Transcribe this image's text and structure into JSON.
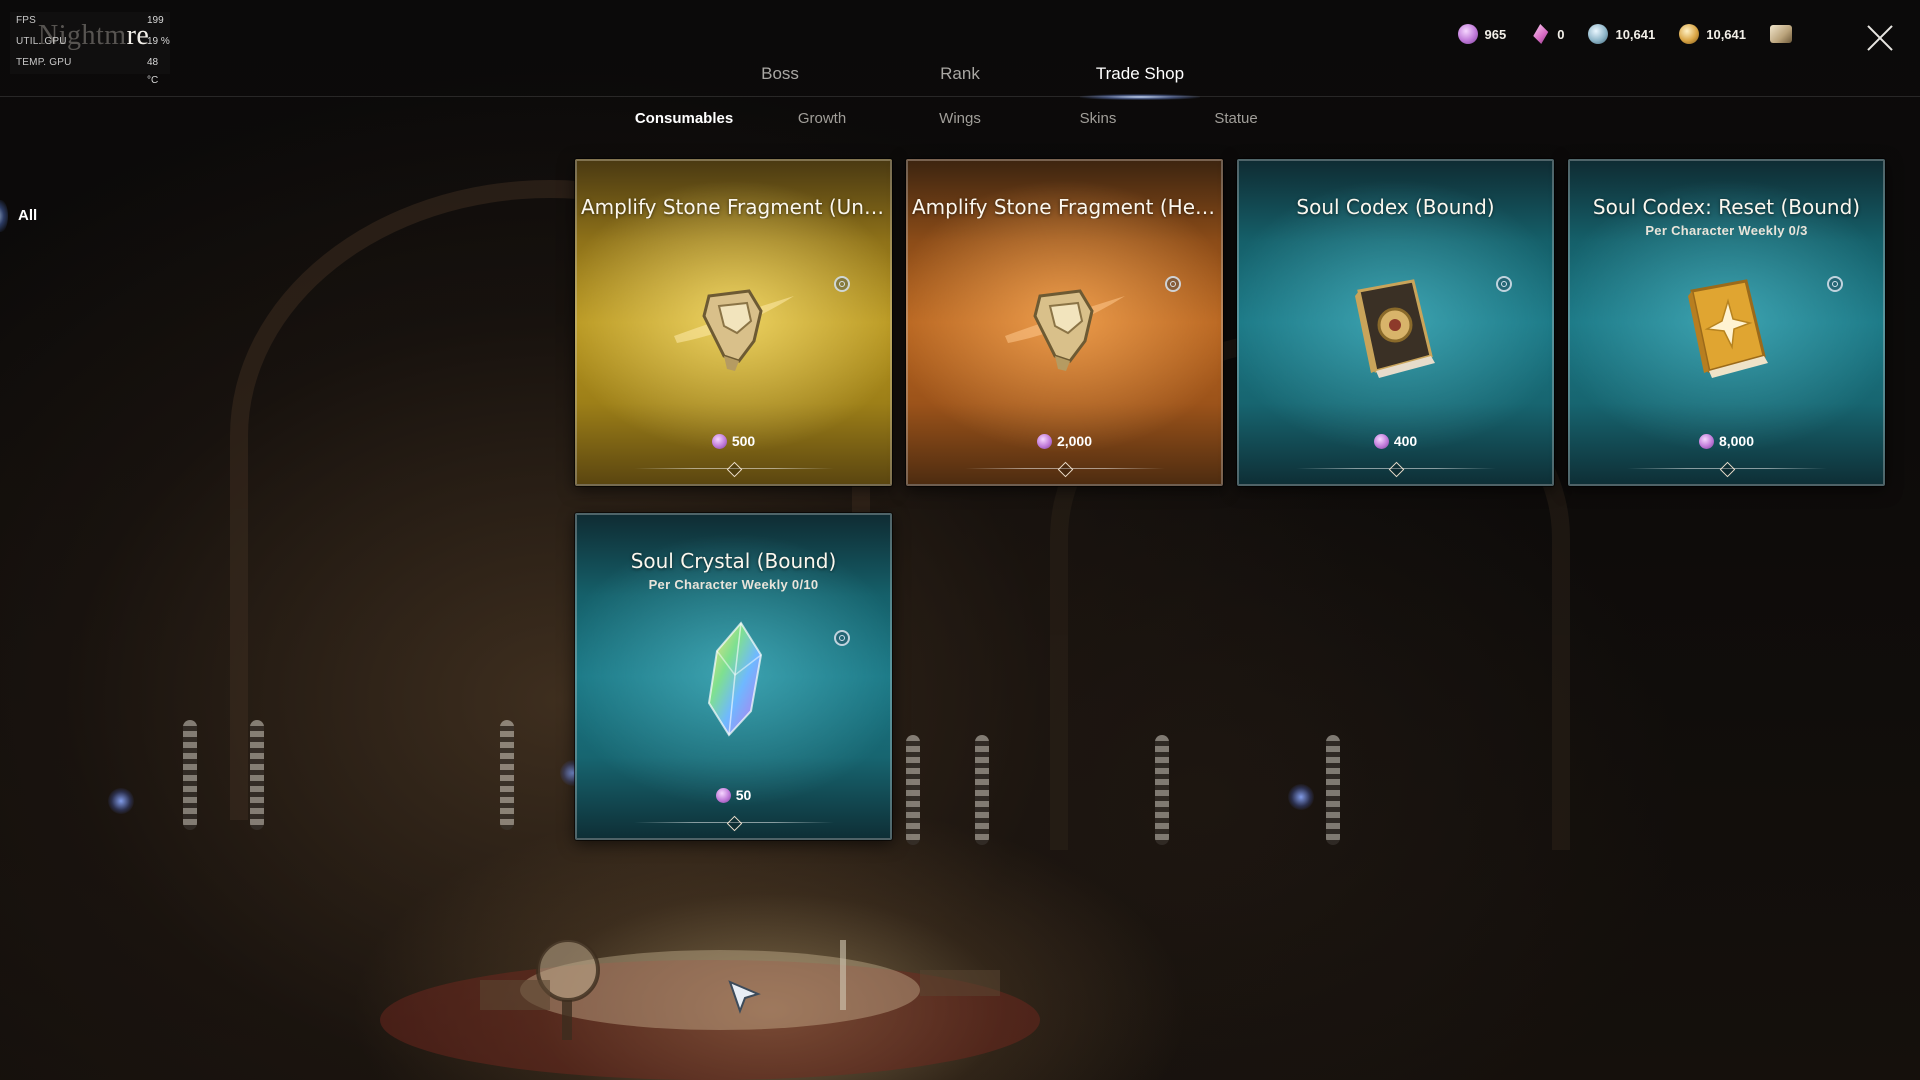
{
  "perf_overlay": {
    "fps_label": "FPS",
    "fps_value": "199",
    "gpu_util_label": "UTIL. GPU",
    "gpu_util_value": "19 %",
    "gpu_temp_label": "TEMP. GPU",
    "gpu_temp_value": "48 °C"
  },
  "page_title": {
    "dim": "Nightm",
    "visible": "re"
  },
  "currencies": [
    {
      "icon": "soul-gem-icon",
      "value": "965"
    },
    {
      "icon": "soul-shard-icon",
      "value": "0"
    },
    {
      "icon": "silver-coin-icon",
      "value": "10,641"
    },
    {
      "icon": "gold-coin-icon",
      "value": "10,641"
    },
    {
      "icon": "scroll-icon",
      "value": ""
    }
  ],
  "main_tabs": [
    {
      "label": "Boss",
      "active": false
    },
    {
      "label": "Rank",
      "active": false
    },
    {
      "label": "Trade Shop",
      "active": true
    }
  ],
  "sub_tabs": [
    {
      "label": "Consumables",
      "active": true
    },
    {
      "label": "Growth",
      "active": false
    },
    {
      "label": "Wings",
      "active": false
    },
    {
      "label": "Skins",
      "active": false
    },
    {
      "label": "Statue",
      "active": false
    }
  ],
  "sidebar": {
    "all_label": "All"
  },
  "items": [
    {
      "name": "Amplify Stone Fragment (Uniqu...",
      "limit": "",
      "price": "500",
      "theme": "gold",
      "art": "amplify-stone-icon"
    },
    {
      "name": "Amplify Stone Fragment (Heroi...",
      "limit": "",
      "price": "2,000",
      "theme": "orange",
      "art": "amplify-stone-icon"
    },
    {
      "name": "Soul Codex (Bound)",
      "limit": "",
      "price": "400",
      "theme": "teal",
      "art": "dark-codex-icon"
    },
    {
      "name": "Soul Codex: Reset (Bound)",
      "limit": "Per Character Weekly 0/3",
      "price": "8,000",
      "theme": "teal",
      "art": "gold-codex-icon"
    },
    {
      "name": "Soul Crystal (Bound)",
      "limit": "Per Character Weekly 0/10",
      "price": "50",
      "theme": "teal",
      "art": "crystal-icon"
    }
  ]
}
